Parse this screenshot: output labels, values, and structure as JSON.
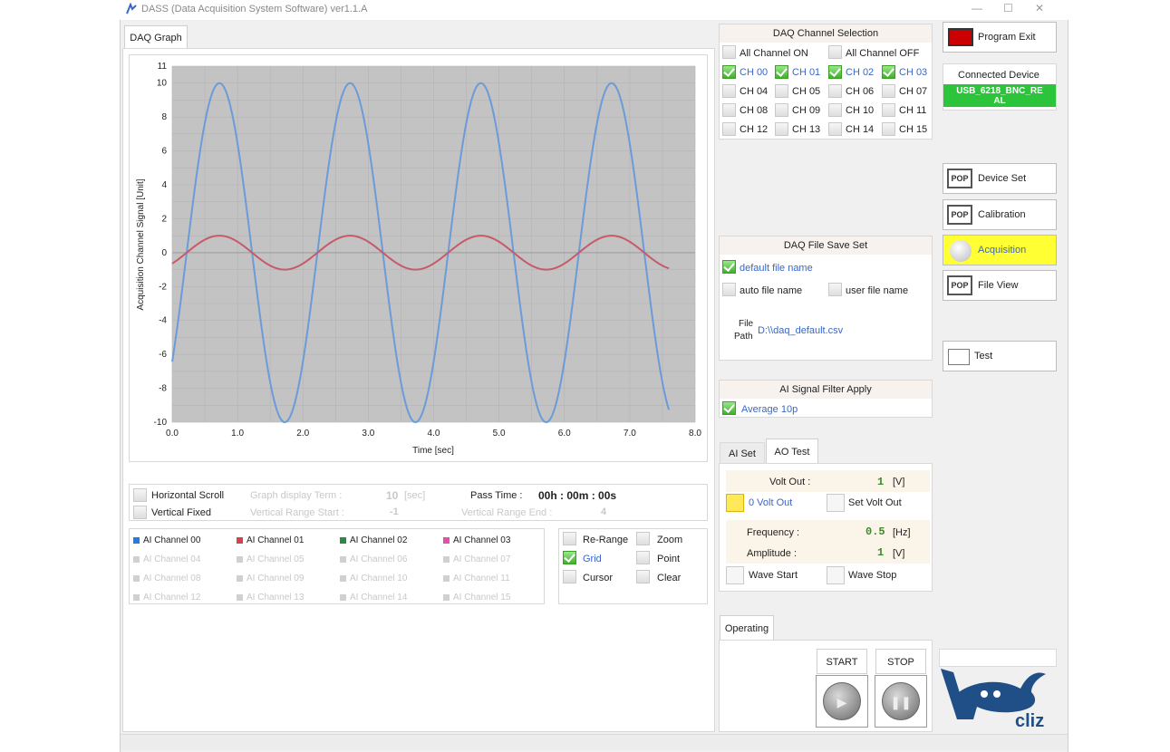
{
  "window": {
    "title": "DASS (Data Acquisition System Software) ver1.1.A"
  },
  "graph_tab": {
    "label": "DAQ Graph"
  },
  "chart_data": {
    "type": "line",
    "xlabel": "Time [sec]",
    "ylabel": "Acquisition Channel Signal [Unit]",
    "xlim": [
      0,
      8
    ],
    "ylim": [
      -10,
      11
    ],
    "x_ticks": [
      "0.0",
      "1.0",
      "2.0",
      "3.0",
      "4.0",
      "5.0",
      "6.0",
      "7.0",
      "8.0"
    ],
    "y_ticks": [
      "11",
      "10",
      "8",
      "6",
      "4",
      "2",
      "0",
      "-2",
      "-4",
      "-6",
      "-8",
      "-10"
    ],
    "grid": true,
    "series": [
      {
        "name": "AI Channel 00",
        "color": "#6b9bd8",
        "amplitude": 10,
        "frequency": 0.5,
        "phase_deg": -40,
        "x_end": 7.6
      },
      {
        "name": "AI Channel 01",
        "color": "#c65a6a",
        "amplitude": 1,
        "frequency": 0.5,
        "phase_deg": -40,
        "x_end": 7.6
      }
    ]
  },
  "graph_controls": {
    "horizontal_scroll": "Horizontal Scroll",
    "vertical_fixed": "Vertical Fixed",
    "graph_display_term_label": "Graph display Term :",
    "graph_display_term_value": "10",
    "graph_display_term_unit": "[sec]",
    "vertical_range_start_label": "Vertical Range Start :",
    "vertical_range_start_value": "-1",
    "vertical_range_end_label": "Vertical Range End :",
    "vertical_range_end_value": "4",
    "pass_time_label": "Pass Time :",
    "pass_time_value": "00h : 00m : 00s"
  },
  "legend": {
    "channels": [
      {
        "label": "AI Channel 00",
        "color": "#1e7fe0",
        "active": true
      },
      {
        "label": "AI Channel 01",
        "color": "#d0444b",
        "active": true
      },
      {
        "label": "AI Channel 02",
        "color": "#2a8a47",
        "active": true
      },
      {
        "label": "AI Channel 03",
        "color": "#e052a6",
        "active": true
      },
      {
        "label": "AI Channel 04",
        "active": false
      },
      {
        "label": "AI Channel 05",
        "active": false
      },
      {
        "label": "AI Channel 06",
        "active": false
      },
      {
        "label": "AI Channel 07",
        "active": false
      },
      {
        "label": "AI Channel 08",
        "active": false
      },
      {
        "label": "AI Channel 09",
        "active": false
      },
      {
        "label": "AI Channel 10",
        "active": false
      },
      {
        "label": "AI Channel 11",
        "active": false
      },
      {
        "label": "AI Channel 12",
        "active": false
      },
      {
        "label": "AI Channel 13",
        "active": false
      },
      {
        "label": "AI Channel 14",
        "active": false
      },
      {
        "label": "AI Channel 15",
        "active": false
      }
    ]
  },
  "graph_options": {
    "rerange": "Re-Range",
    "zoom": "Zoom",
    "grid": "Grid",
    "point": "Point",
    "cursor": "Cursor",
    "clear": "Clear"
  },
  "daq_channel": {
    "title": "DAQ Channel Selection",
    "all_on": "All Channel ON",
    "all_off": "All Channel OFF",
    "channels": [
      "CH 00",
      "CH 01",
      "CH 02",
      "CH 03",
      "CH 04",
      "CH 05",
      "CH 06",
      "CH 07",
      "CH 08",
      "CH 09",
      "CH 10",
      "CH 11",
      "CH 12",
      "CH 13",
      "CH 14",
      "CH 15"
    ],
    "checked": [
      true,
      true,
      true,
      true,
      false,
      false,
      false,
      false,
      false,
      false,
      false,
      false,
      false,
      false,
      false,
      false
    ]
  },
  "file_save": {
    "title": "DAQ File Save Set",
    "default_name": "default file name",
    "auto_name": "auto file name",
    "user_name": "user file name",
    "file_label_1": "File",
    "file_label_2": "Path",
    "file_path": "D:\\\\daq_default.csv"
  },
  "filter": {
    "title": "AI Signal Filter Apply",
    "option": "Average 10p"
  },
  "set_tabs": {
    "ai_set": "AI Set",
    "ao_test": "AO Test"
  },
  "ao_test": {
    "volt_out_label": "Volt Out :",
    "volt_out_value": "1",
    "volt_out_unit": "[V]",
    "zero_volt_out": "0 Volt Out",
    "set_volt_out": "Set Volt Out",
    "frequency_label": "Frequency :",
    "frequency_value": "0.5",
    "frequency_unit": "[Hz]",
    "amplitude_label": "Amplitude :",
    "amplitude_value": "1",
    "amplitude_unit": "[V]",
    "wave_start": "Wave Start",
    "wave_stop": "Wave Stop"
  },
  "operating": {
    "tab": "Operating",
    "start": "START",
    "stop": "STOP"
  },
  "side": {
    "program_exit": "Program Exit",
    "connected_device_label": "Connected Device",
    "connected_device_value_1": "USB_6218_BNC_RE",
    "connected_device_value_2": "AL",
    "device_set": "Device Set",
    "calibration": "Calibration",
    "acquisition": "Acquisition",
    "file_view": "File View",
    "test": "Test",
    "pop": "POP"
  },
  "brand": {
    "logo_text": "cliz"
  },
  "colors": {
    "plot_bg": "#c3c3c3",
    "acquisition_active": "#ffff33",
    "device_green": "#2bc43a"
  }
}
